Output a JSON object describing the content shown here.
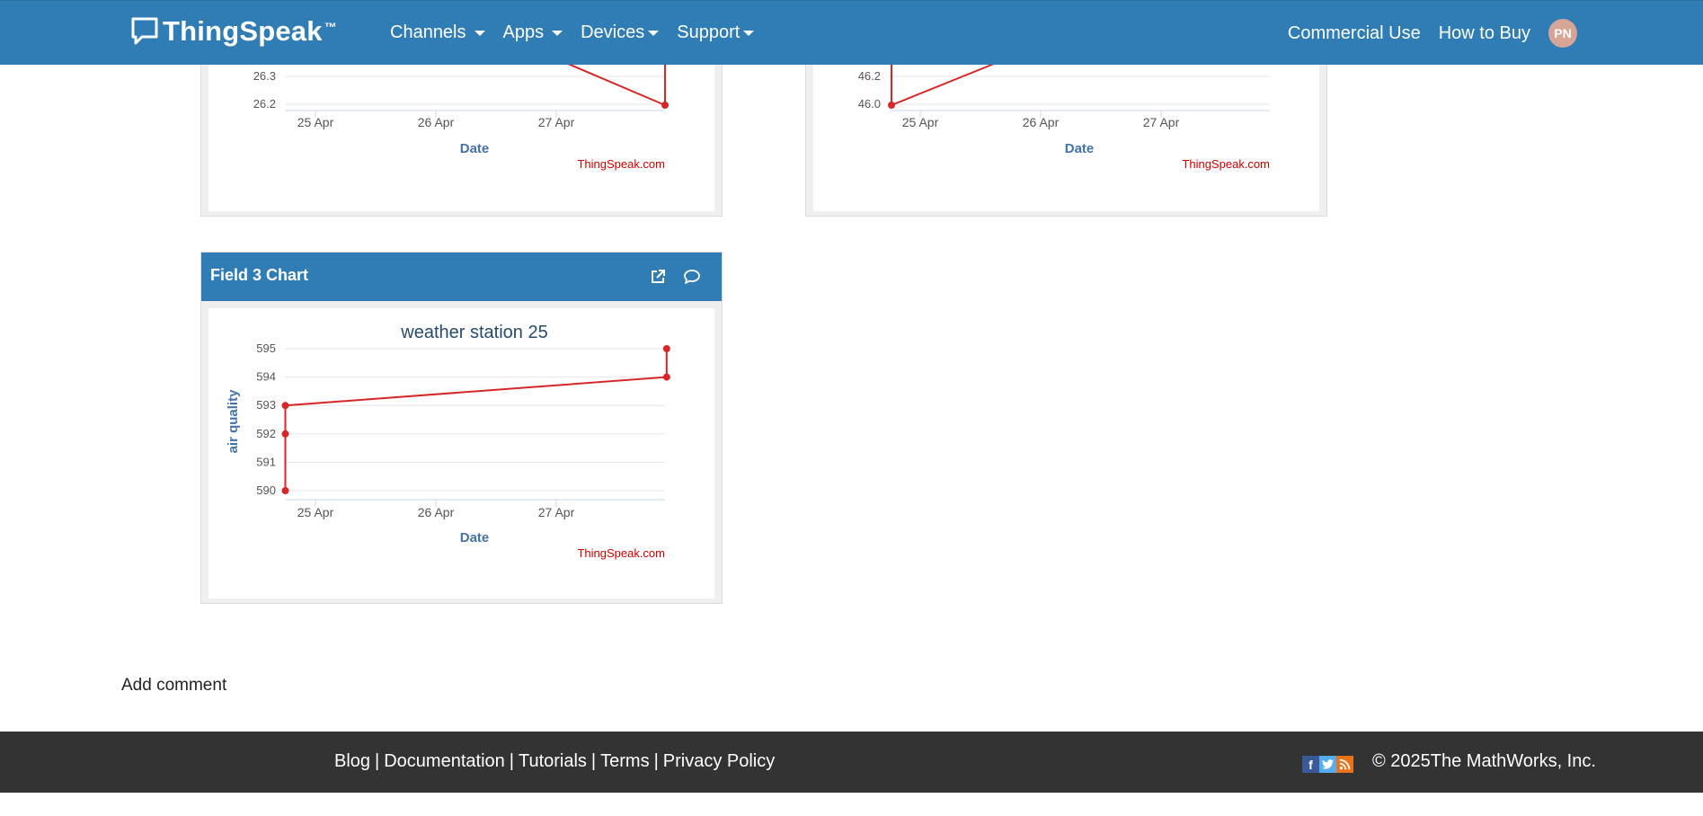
{
  "navbar": {
    "brand": "ThingSpeak",
    "brand_tm": "™",
    "menus": [
      "Channels",
      "Apps",
      "Devices",
      "Support"
    ],
    "right_links": [
      "Commercial Use",
      "How to Buy"
    ],
    "avatar_initials": "PN"
  },
  "chart_data": [
    {
      "type": "line",
      "title": "",
      "xlabel": "Date",
      "ylabel": "",
      "x_ticks": [
        "25 Apr",
        "26 Apr",
        "27 Apr"
      ],
      "y_ticks_visible": [
        "26.3",
        "26.2"
      ],
      "credit": "ThingSpeak.com",
      "series": [
        {
          "points": [
            {
              "x": "2025-04-27T22:00",
              "y": 26.2
            }
          ]
        }
      ]
    },
    {
      "type": "line",
      "title": "",
      "xlabel": "Date",
      "ylabel": "",
      "x_ticks": [
        "25 Apr",
        "26 Apr",
        "27 Apr"
      ],
      "y_ticks_visible": [
        "46.2",
        "46.0"
      ],
      "credit": "ThingSpeak.com",
      "series": [
        {
          "points": [
            {
              "x": "2025-04-24T18:00",
              "y": 46.0
            }
          ]
        }
      ]
    },
    {
      "type": "line",
      "panel_title": "Field 3 Chart",
      "title": "weather station 25",
      "xlabel": "Date",
      "ylabel": "air quality",
      "x_ticks": [
        "25 Apr",
        "26 Apr",
        "27 Apr"
      ],
      "y_ticks": [
        "595",
        "594",
        "593",
        "592",
        "591",
        "590"
      ],
      "ylim": [
        590,
        595
      ],
      "credit": "ThingSpeak.com",
      "series": [
        {
          "points": [
            {
              "x": "2025-04-24T18:00",
              "y": 590
            },
            {
              "x": "2025-04-24T18:00",
              "y": 592
            },
            {
              "x": "2025-04-24T18:00",
              "y": 593
            },
            {
              "x": "2025-04-27T22:00",
              "y": 594
            },
            {
              "x": "2025-04-27T22:00",
              "y": 595
            }
          ]
        }
      ],
      "line_color": "#d62728"
    }
  ],
  "add_comment": "Add comment",
  "footer": {
    "links": [
      "Blog",
      "Documentation",
      "Tutorials",
      "Terms",
      "Privacy Policy"
    ],
    "copyright": "© 2025The MathWorks, Inc."
  },
  "colors": {
    "navbar": "#2f7db4",
    "footer": "#333333",
    "series": "#d62728",
    "axis_label": "#4572a7"
  }
}
